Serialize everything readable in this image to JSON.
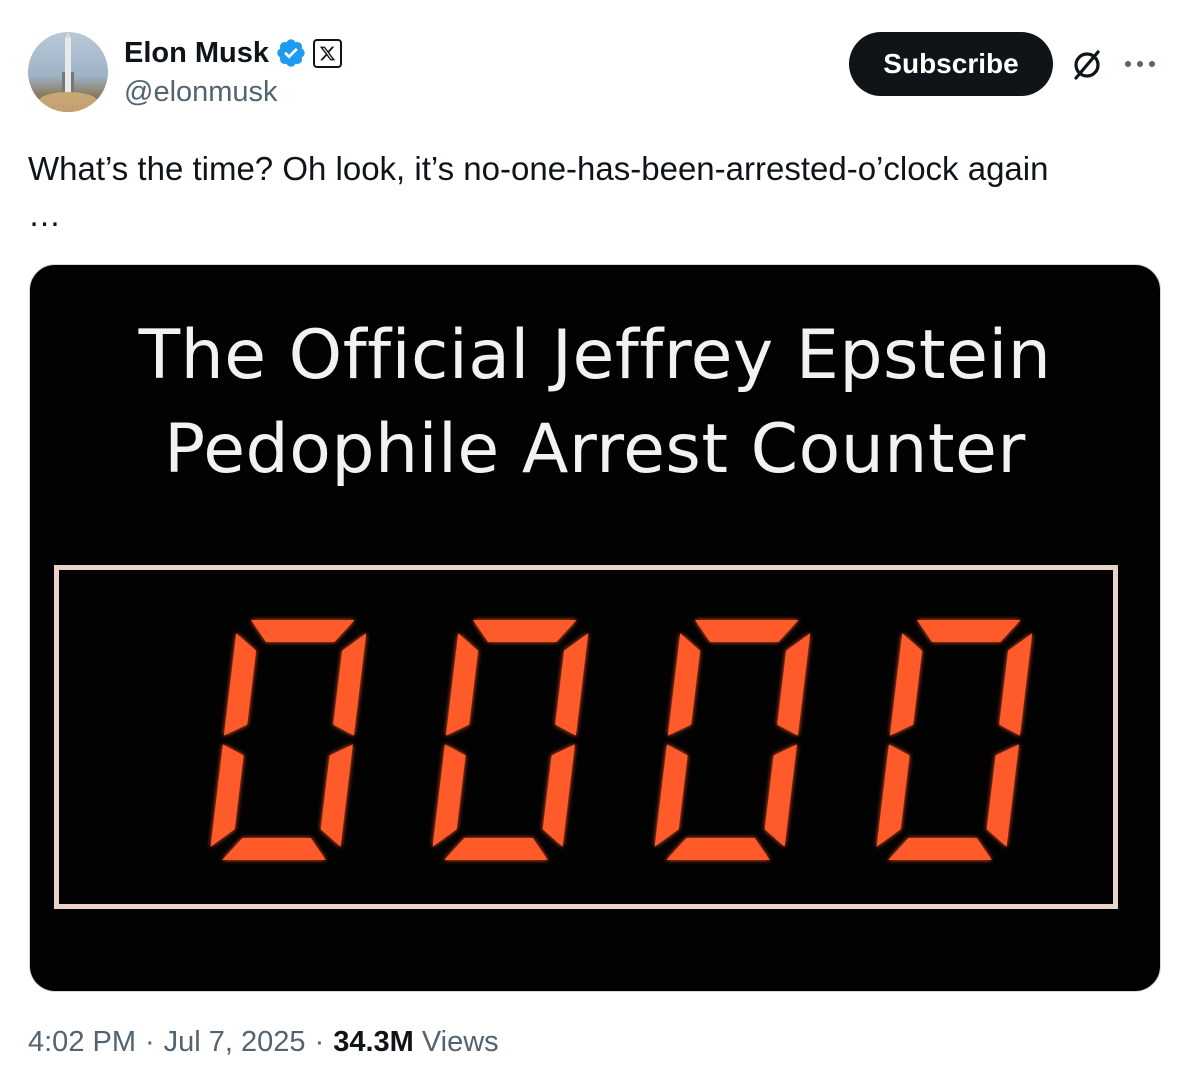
{
  "author": {
    "name": "Elon Musk",
    "handle": "@elonmusk",
    "verified_icon": "verified-badge-icon",
    "affiliation_icon": "x-logo-icon"
  },
  "actions": {
    "subscribe_label": "Subscribe",
    "grok_icon": "grok-icon",
    "more_icon": "more-icon"
  },
  "post": {
    "text": "What’s the time? Oh look, it’s no-one-has-been-arrested-o’clock again\n…"
  },
  "media": {
    "title_line1": "The Official Jeffrey Epstein",
    "title_line2": "Pedophile Arrest Counter",
    "counter_value": "0000",
    "digit_color": "#ff5a2a"
  },
  "footer": {
    "time": "4:02 PM",
    "separator": "·",
    "date": "Jul 7, 2025",
    "views_count": "34.3M",
    "views_label": "Views"
  },
  "colors": {
    "accent": "#0f1419",
    "verified": "#1d9bf0",
    "secondary_text": "#536471"
  }
}
